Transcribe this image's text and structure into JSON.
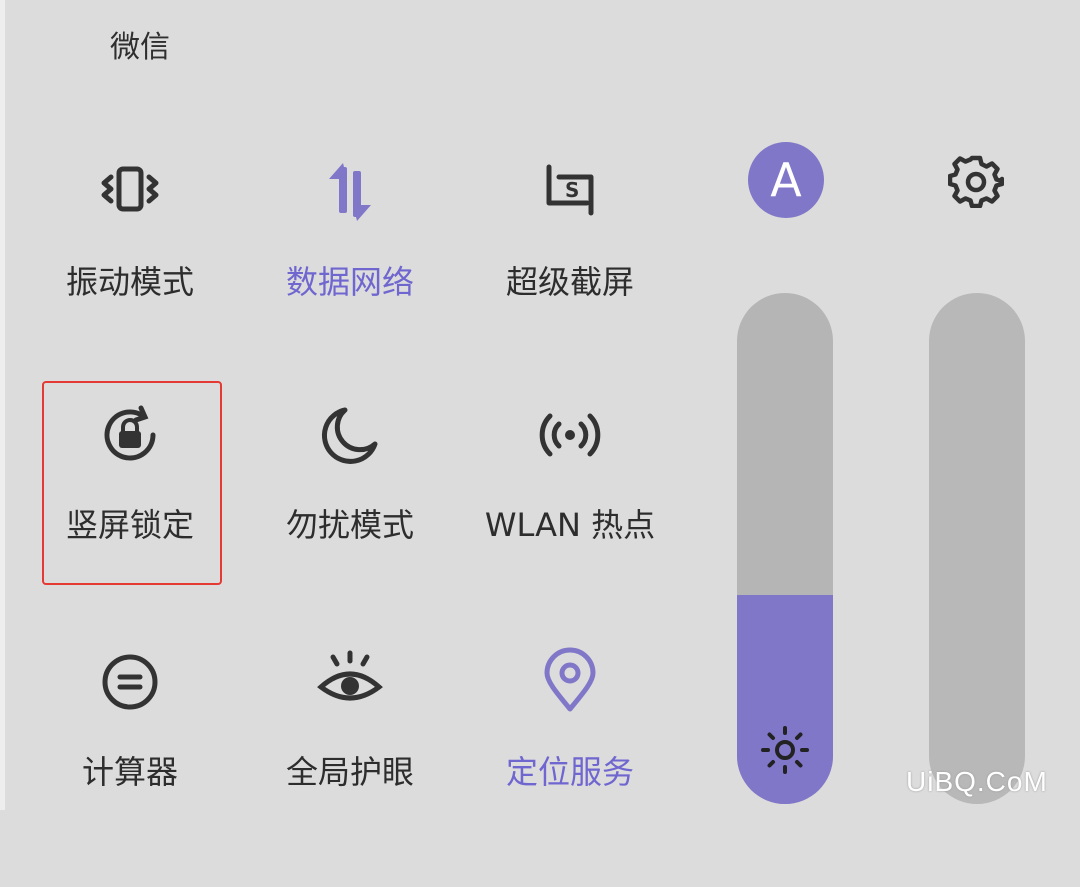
{
  "header": {
    "app_label": "微信"
  },
  "tiles": [
    {
      "label": "振动模式",
      "icon": "vibration-icon",
      "active": false
    },
    {
      "label": "数据网络",
      "icon": "data-arrows-icon",
      "active": true
    },
    {
      "label": "超级截屏",
      "icon": "super-screenshot-icon",
      "active": false
    },
    {
      "label": "竖屏锁定",
      "icon": "rotation-lock-icon",
      "active": false
    },
    {
      "label": "勿扰模式",
      "icon": "moon-icon",
      "active": false
    },
    {
      "label": "WLAN 热点",
      "icon": "hotspot-icon",
      "active": false
    },
    {
      "label": "计算器",
      "icon": "calculator-icon",
      "active": false
    },
    {
      "label": "全局护眼",
      "icon": "eye-icon",
      "active": false
    },
    {
      "label": "定位服务",
      "icon": "location-pin-icon",
      "active": true
    }
  ],
  "side": {
    "auto_brightness_label": "A",
    "settings_icon": "gear-icon",
    "brightness_level": 0.41,
    "volume_level": 0.0
  },
  "colors": {
    "background": "#dcdcdc",
    "accent": "#8077c9",
    "active_text": "#6f66cf",
    "text": "#2d2d2d",
    "highlight": "#e53935"
  },
  "watermark": "UiBQ.CoM"
}
